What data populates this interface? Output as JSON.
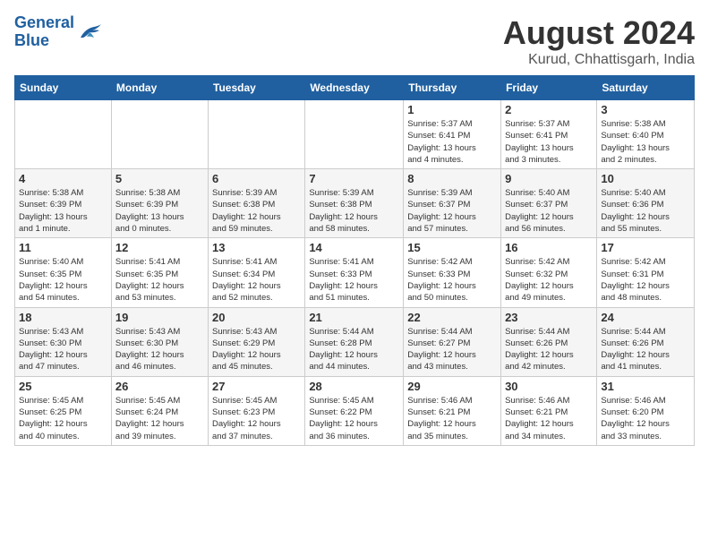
{
  "header": {
    "logo_line1": "General",
    "logo_line2": "Blue",
    "month_year": "August 2024",
    "location": "Kurud, Chhattisgarh, India"
  },
  "days_of_week": [
    "Sunday",
    "Monday",
    "Tuesday",
    "Wednesday",
    "Thursday",
    "Friday",
    "Saturday"
  ],
  "weeks": [
    [
      {
        "day": "",
        "info": ""
      },
      {
        "day": "",
        "info": ""
      },
      {
        "day": "",
        "info": ""
      },
      {
        "day": "",
        "info": ""
      },
      {
        "day": "1",
        "info": "Sunrise: 5:37 AM\nSunset: 6:41 PM\nDaylight: 13 hours\nand 4 minutes."
      },
      {
        "day": "2",
        "info": "Sunrise: 5:37 AM\nSunset: 6:41 PM\nDaylight: 13 hours\nand 3 minutes."
      },
      {
        "day": "3",
        "info": "Sunrise: 5:38 AM\nSunset: 6:40 PM\nDaylight: 13 hours\nand 2 minutes."
      }
    ],
    [
      {
        "day": "4",
        "info": "Sunrise: 5:38 AM\nSunset: 6:39 PM\nDaylight: 13 hours\nand 1 minute."
      },
      {
        "day": "5",
        "info": "Sunrise: 5:38 AM\nSunset: 6:39 PM\nDaylight: 13 hours\nand 0 minutes."
      },
      {
        "day": "6",
        "info": "Sunrise: 5:39 AM\nSunset: 6:38 PM\nDaylight: 12 hours\nand 59 minutes."
      },
      {
        "day": "7",
        "info": "Sunrise: 5:39 AM\nSunset: 6:38 PM\nDaylight: 12 hours\nand 58 minutes."
      },
      {
        "day": "8",
        "info": "Sunrise: 5:39 AM\nSunset: 6:37 PM\nDaylight: 12 hours\nand 57 minutes."
      },
      {
        "day": "9",
        "info": "Sunrise: 5:40 AM\nSunset: 6:37 PM\nDaylight: 12 hours\nand 56 minutes."
      },
      {
        "day": "10",
        "info": "Sunrise: 5:40 AM\nSunset: 6:36 PM\nDaylight: 12 hours\nand 55 minutes."
      }
    ],
    [
      {
        "day": "11",
        "info": "Sunrise: 5:40 AM\nSunset: 6:35 PM\nDaylight: 12 hours\nand 54 minutes."
      },
      {
        "day": "12",
        "info": "Sunrise: 5:41 AM\nSunset: 6:35 PM\nDaylight: 12 hours\nand 53 minutes."
      },
      {
        "day": "13",
        "info": "Sunrise: 5:41 AM\nSunset: 6:34 PM\nDaylight: 12 hours\nand 52 minutes."
      },
      {
        "day": "14",
        "info": "Sunrise: 5:41 AM\nSunset: 6:33 PM\nDaylight: 12 hours\nand 51 minutes."
      },
      {
        "day": "15",
        "info": "Sunrise: 5:42 AM\nSunset: 6:33 PM\nDaylight: 12 hours\nand 50 minutes."
      },
      {
        "day": "16",
        "info": "Sunrise: 5:42 AM\nSunset: 6:32 PM\nDaylight: 12 hours\nand 49 minutes."
      },
      {
        "day": "17",
        "info": "Sunrise: 5:42 AM\nSunset: 6:31 PM\nDaylight: 12 hours\nand 48 minutes."
      }
    ],
    [
      {
        "day": "18",
        "info": "Sunrise: 5:43 AM\nSunset: 6:30 PM\nDaylight: 12 hours\nand 47 minutes."
      },
      {
        "day": "19",
        "info": "Sunrise: 5:43 AM\nSunset: 6:30 PM\nDaylight: 12 hours\nand 46 minutes."
      },
      {
        "day": "20",
        "info": "Sunrise: 5:43 AM\nSunset: 6:29 PM\nDaylight: 12 hours\nand 45 minutes."
      },
      {
        "day": "21",
        "info": "Sunrise: 5:44 AM\nSunset: 6:28 PM\nDaylight: 12 hours\nand 44 minutes."
      },
      {
        "day": "22",
        "info": "Sunrise: 5:44 AM\nSunset: 6:27 PM\nDaylight: 12 hours\nand 43 minutes."
      },
      {
        "day": "23",
        "info": "Sunrise: 5:44 AM\nSunset: 6:26 PM\nDaylight: 12 hours\nand 42 minutes."
      },
      {
        "day": "24",
        "info": "Sunrise: 5:44 AM\nSunset: 6:26 PM\nDaylight: 12 hours\nand 41 minutes."
      }
    ],
    [
      {
        "day": "25",
        "info": "Sunrise: 5:45 AM\nSunset: 6:25 PM\nDaylight: 12 hours\nand 40 minutes."
      },
      {
        "day": "26",
        "info": "Sunrise: 5:45 AM\nSunset: 6:24 PM\nDaylight: 12 hours\nand 39 minutes."
      },
      {
        "day": "27",
        "info": "Sunrise: 5:45 AM\nSunset: 6:23 PM\nDaylight: 12 hours\nand 37 minutes."
      },
      {
        "day": "28",
        "info": "Sunrise: 5:45 AM\nSunset: 6:22 PM\nDaylight: 12 hours\nand 36 minutes."
      },
      {
        "day": "29",
        "info": "Sunrise: 5:46 AM\nSunset: 6:21 PM\nDaylight: 12 hours\nand 35 minutes."
      },
      {
        "day": "30",
        "info": "Sunrise: 5:46 AM\nSunset: 6:21 PM\nDaylight: 12 hours\nand 34 minutes."
      },
      {
        "day": "31",
        "info": "Sunrise: 5:46 AM\nSunset: 6:20 PM\nDaylight: 12 hours\nand 33 minutes."
      }
    ]
  ]
}
